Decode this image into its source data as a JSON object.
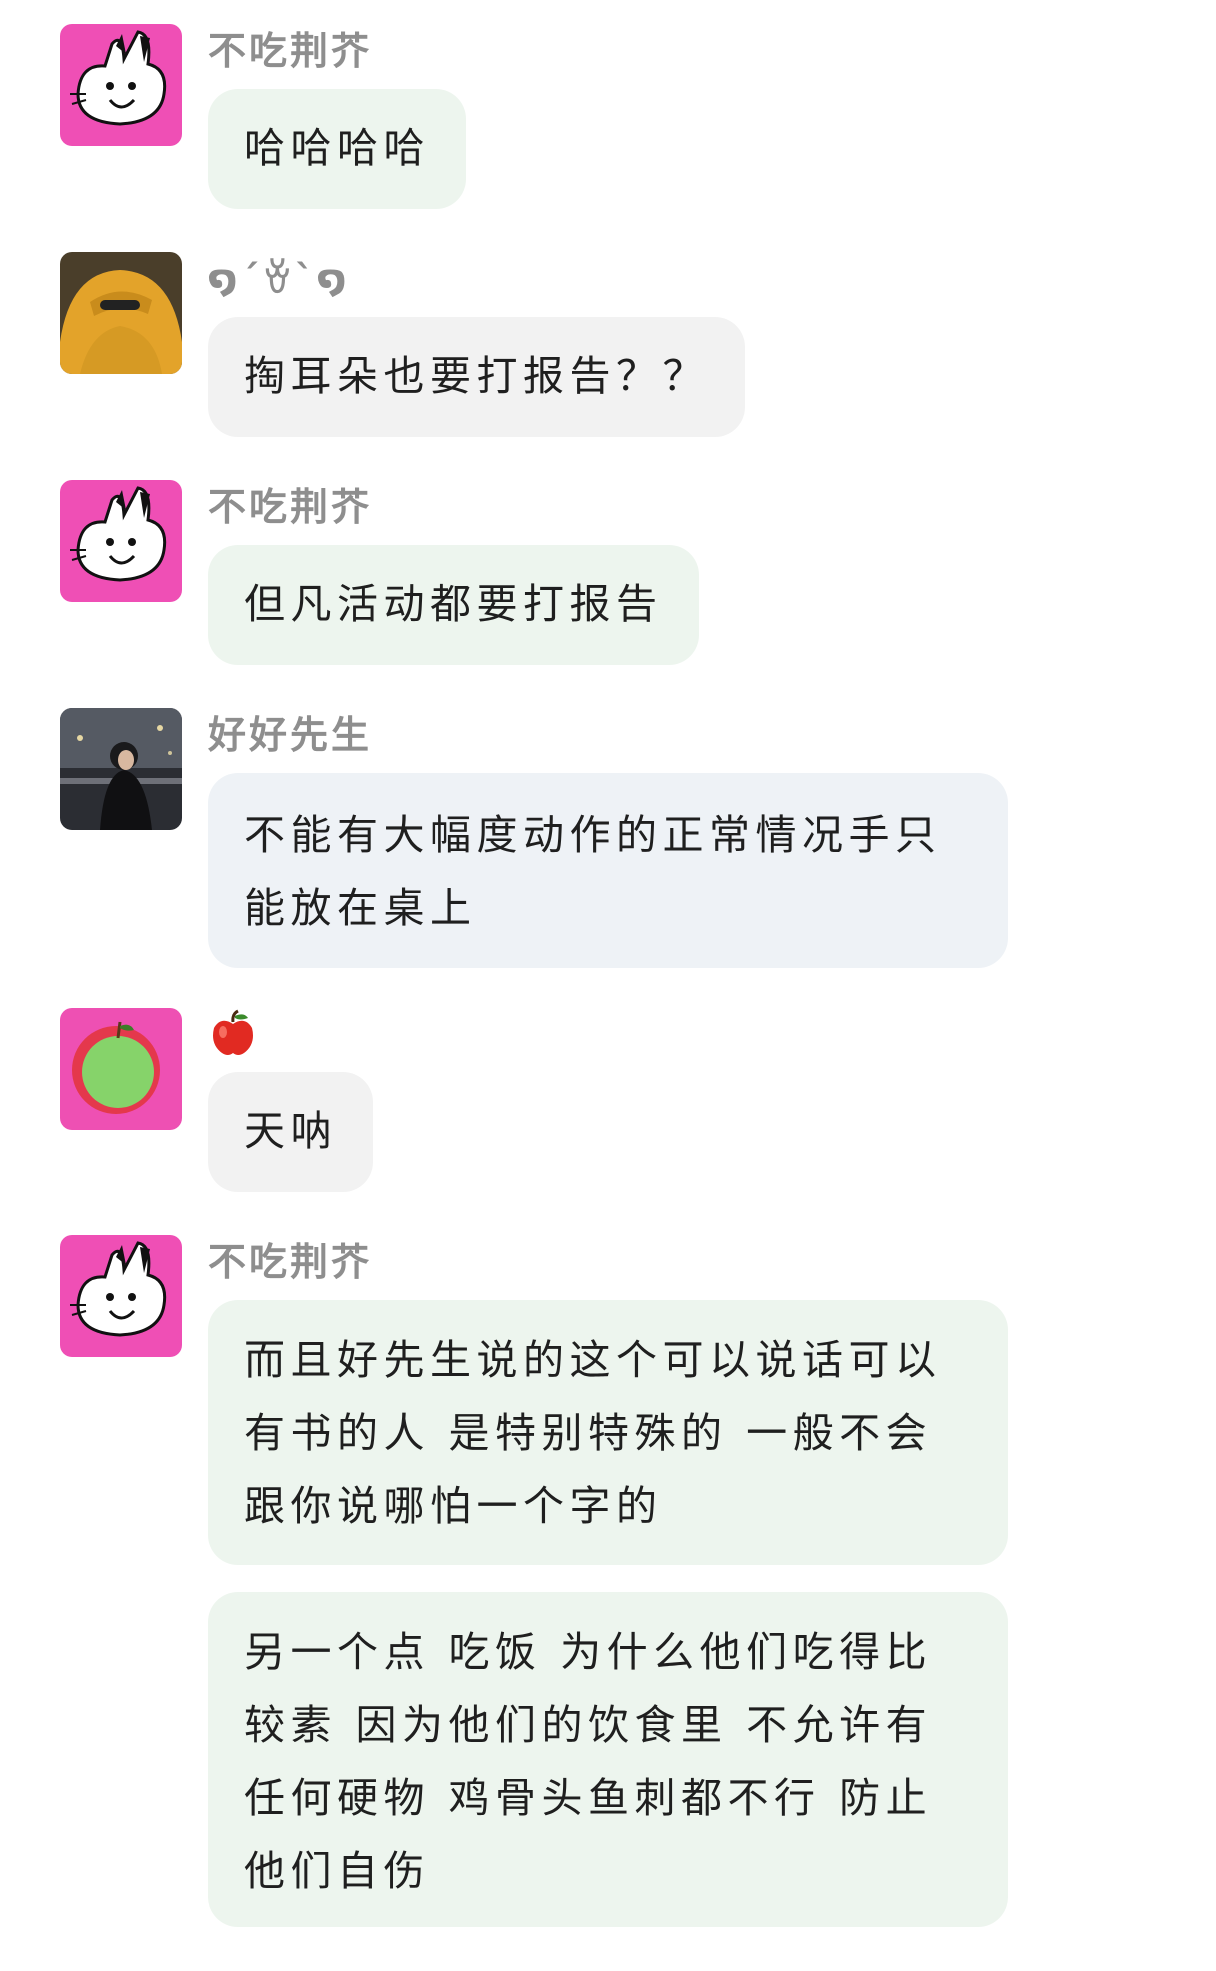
{
  "messages": [
    {
      "sender": "不吃荆芥",
      "avatar": "bunny-pink-avatar",
      "text": "哈哈哈哈"
    },
    {
      "sender": "໑´ꈊ`໑",
      "avatar": "yellow-hood-avatar",
      "text": "掏耳朵也要打报告？？"
    },
    {
      "sender": "不吃荆芥",
      "avatar": "bunny-pink-avatar",
      "text": "但凡活动都要打报告"
    },
    {
      "sender": "好好先生",
      "avatar": "night-city-photo-avatar",
      "text": "不能有大幅度动作的正常情况手只能放在桌上"
    },
    {
      "sender": "apple-emoji",
      "avatar": "green-apple-pink-avatar",
      "text": "天呐"
    },
    {
      "sender": "不吃荆芥",
      "avatar": "bunny-pink-avatar",
      "text": "而且好先生说的这个可以说话可以有书的人 是特别特殊的 一般不会跟你说哪怕一个字的"
    },
    {
      "sender": "",
      "avatar": "",
      "text": "另一个点 吃饭 为什么他们吃得比较素 因为他们的饮食里 不允许有任何硬物 鸡骨头鱼刺都不行 防止他们自伤"
    }
  ],
  "colors": {
    "bubble_green": "#edf5ee",
    "bubble_gray": "#f2f2f2",
    "bubble_blue": "#eef2f6",
    "sender_name": "#8e8e8e",
    "bunny_bg": "#ef4fb5"
  }
}
